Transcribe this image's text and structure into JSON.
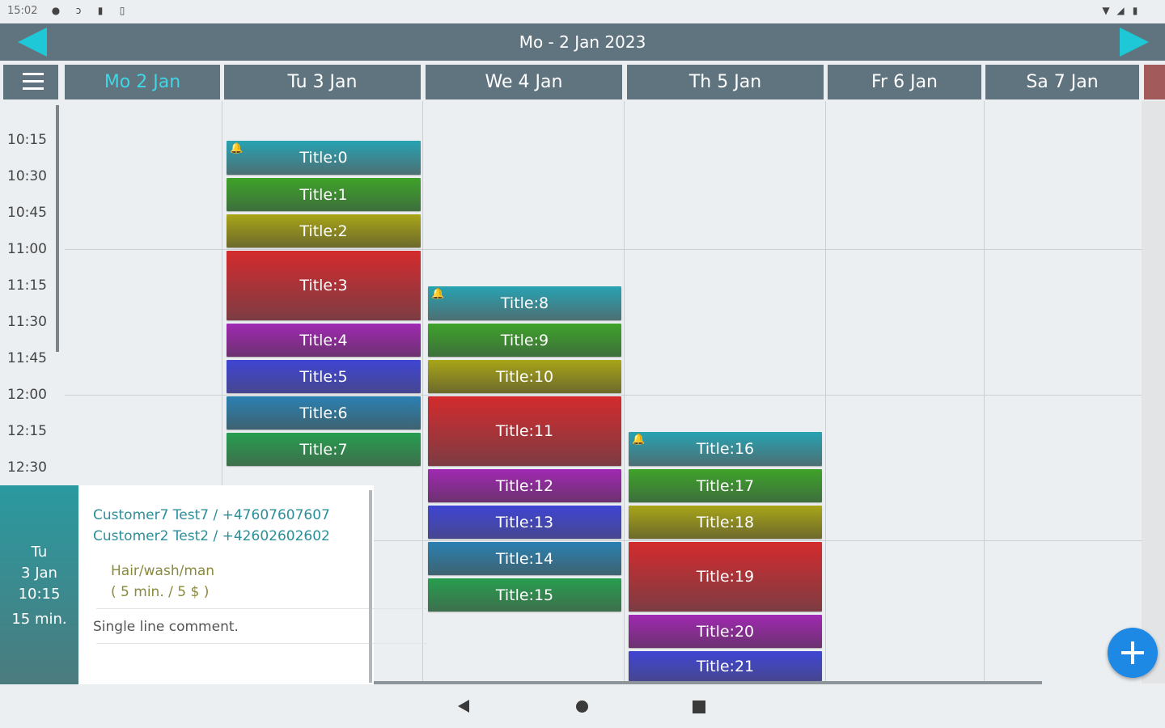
{
  "status_bar": {
    "time": "15:02",
    "icons": [
      "notification-icon",
      "nfc-icon",
      "sd-card-icon",
      "clipboard-icon",
      "wifi-icon",
      "signal-icon",
      "battery-icon"
    ]
  },
  "top_bar": {
    "title": "Mo - 2 Jan 2023",
    "prev_icon": "left-arrow-icon",
    "next_icon": "right-arrow-icon"
  },
  "day_headers": [
    {
      "label": "Mo   2 Jan",
      "color": "#40d6e3"
    },
    {
      "label": "Tu   3 Jan",
      "color": "#ffffff"
    },
    {
      "label": "We   4 Jan",
      "color": "#ffffff"
    },
    {
      "label": "Th   5 Jan",
      "color": "#ffffff"
    },
    {
      "label": "Fr   6 Jan",
      "color": "#ffffff"
    },
    {
      "label": "Sa   7 Jan",
      "color": "#ffffff"
    }
  ],
  "time_labels": [
    "10:15",
    "10:30",
    "10:45",
    "11:00",
    "11:15",
    "11:30",
    "11:45",
    "12:00",
    "12:15",
    "12:30"
  ],
  "events": [
    {
      "title": "Title:0",
      "day": "Tu",
      "start": "10:15",
      "end": "10:30",
      "has_bell": true
    },
    {
      "title": "Title:1",
      "day": "Tu",
      "start": "10:30",
      "end": "10:45"
    },
    {
      "title": "Title:2",
      "day": "Tu",
      "start": "10:45",
      "end": "11:00"
    },
    {
      "title": "Title:3",
      "day": "Tu",
      "start": "11:00",
      "end": "11:30"
    },
    {
      "title": "Title:4",
      "day": "Tu",
      "start": "11:30",
      "end": "11:45"
    },
    {
      "title": "Title:5",
      "day": "Tu",
      "start": "11:45",
      "end": "12:00"
    },
    {
      "title": "Title:6",
      "day": "Tu",
      "start": "12:00",
      "end": "12:15"
    },
    {
      "title": "Title:7",
      "day": "Tu",
      "start": "12:15",
      "end": "12:30"
    },
    {
      "title": "Title:8",
      "day": "We",
      "start": "11:15",
      "end": "11:30",
      "has_bell": true
    },
    {
      "title": "Title:9",
      "day": "We",
      "start": "11:30",
      "end": "11:45"
    },
    {
      "title": "Title:10",
      "day": "We",
      "start": "11:45",
      "end": "12:00"
    },
    {
      "title": "Title:11",
      "day": "We",
      "start": "12:00",
      "end": "12:30"
    },
    {
      "title": "Title:12",
      "day": "We",
      "start": "12:30",
      "end": "12:45"
    },
    {
      "title": "Title:13",
      "day": "We",
      "start": "12:45",
      "end": "13:00"
    },
    {
      "title": "Title:14",
      "day": "We",
      "start": "13:00",
      "end": "13:15"
    },
    {
      "title": "Title:15",
      "day": "We",
      "start": "13:15",
      "end": "13:30"
    },
    {
      "title": "Title:16",
      "day": "Th",
      "start": "12:15",
      "end": "12:30",
      "has_bell": true
    },
    {
      "title": "Title:17",
      "day": "Th",
      "start": "12:30",
      "end": "12:45"
    },
    {
      "title": "Title:18",
      "day": "Th",
      "start": "12:45",
      "end": "13:00"
    },
    {
      "title": "Title:19",
      "day": "Th",
      "start": "13:00",
      "end": "13:30"
    },
    {
      "title": "Title:20",
      "day": "Th",
      "start": "13:30",
      "end": "13:45"
    },
    {
      "title": "Title:21",
      "day": "Th",
      "start": "13:45",
      "end": "14:00"
    }
  ],
  "detail": {
    "day": "Tu",
    "date": "3 Jan",
    "time": "10:15",
    "duration": "15 min.",
    "customers": [
      "Customer7 Test7 / +47607607607",
      "Customer2 Test2 / +42602602602"
    ],
    "service": "Hair/wash/man",
    "service_meta": "(  5 min.  /  5 $  )",
    "comment": "Single line comment."
  },
  "fab_icon": "add-icon",
  "nav_bar": {
    "icons": [
      "back-icon",
      "home-icon",
      "recents-icon"
    ]
  }
}
